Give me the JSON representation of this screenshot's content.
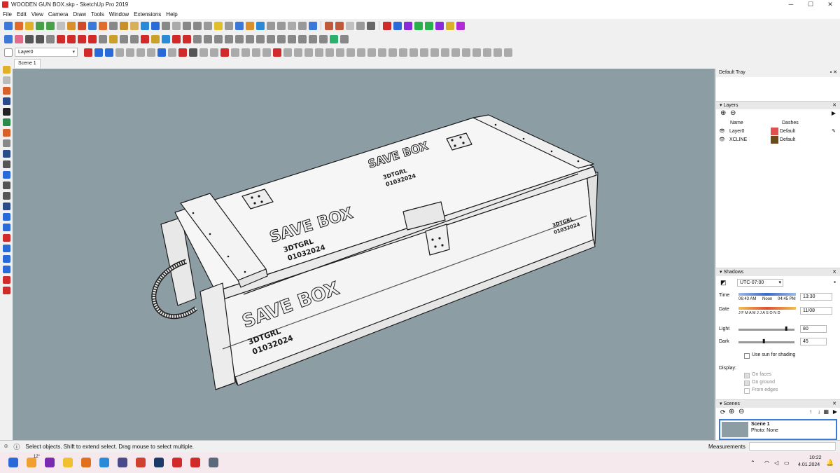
{
  "window": {
    "title": "WOODEN GUN BOX.skp - SketchUp Pro 2019",
    "minimize": "─",
    "maximize": "☐",
    "close": "✕"
  },
  "menu": [
    "File",
    "Edit",
    "View",
    "Camera",
    "Draw",
    "Tools",
    "Window",
    "Extensions",
    "Help"
  ],
  "toolbar": {
    "layer_select_value": "Layer0"
  },
  "scene_tab": "Scene 1",
  "model": {
    "label_top": "SAVE BOX",
    "label_lid": "SAVE BOX",
    "label_front": "SAVE BOX",
    "code_name": "3DTGRL",
    "code_date": "01032024"
  },
  "tray": {
    "title": "Default Tray",
    "layers": {
      "panel_title": "Layers",
      "col_name": "Name",
      "col_dashes": "Dashes",
      "rows": [
        {
          "name": "Layer0",
          "dashes": "Default",
          "color": "#e05050"
        },
        {
          "name": "XCLINE",
          "dashes": "Default",
          "color": "#6b4a1a"
        }
      ]
    },
    "shadows": {
      "panel_title": "Shadows",
      "timezone": "UTC-07:00",
      "time_label": "Time",
      "time_start": "06:43 AM",
      "time_noon": "Noon",
      "time_end": "04:45 PM",
      "time_value": "13:30",
      "date_label": "Date",
      "months": "J F M A M J J A S O N D",
      "date_value": "11/08",
      "light_label": "Light",
      "light_value": "80",
      "dark_label": "Dark",
      "dark_value": "45",
      "use_sun": "Use sun for shading",
      "display_label": "Display:",
      "on_faces": "On faces",
      "on_ground": "On ground",
      "from_edges": "From edges"
    },
    "scenes": {
      "panel_title": "Scenes",
      "scene_name": "Scene 1",
      "scene_photo": "Photo: None"
    }
  },
  "status": {
    "hint": "Select objects. Shift to extend select. Drag mouse to select multiple.",
    "measurements": "Measurements"
  },
  "taskbar": {
    "weather": "12°",
    "time": "10:22",
    "date": "4.01.2024"
  },
  "colors": {
    "viewport_bg": "#8c9ea4",
    "model_face": "#f2f2f2",
    "edge": "#1a1a1a"
  }
}
